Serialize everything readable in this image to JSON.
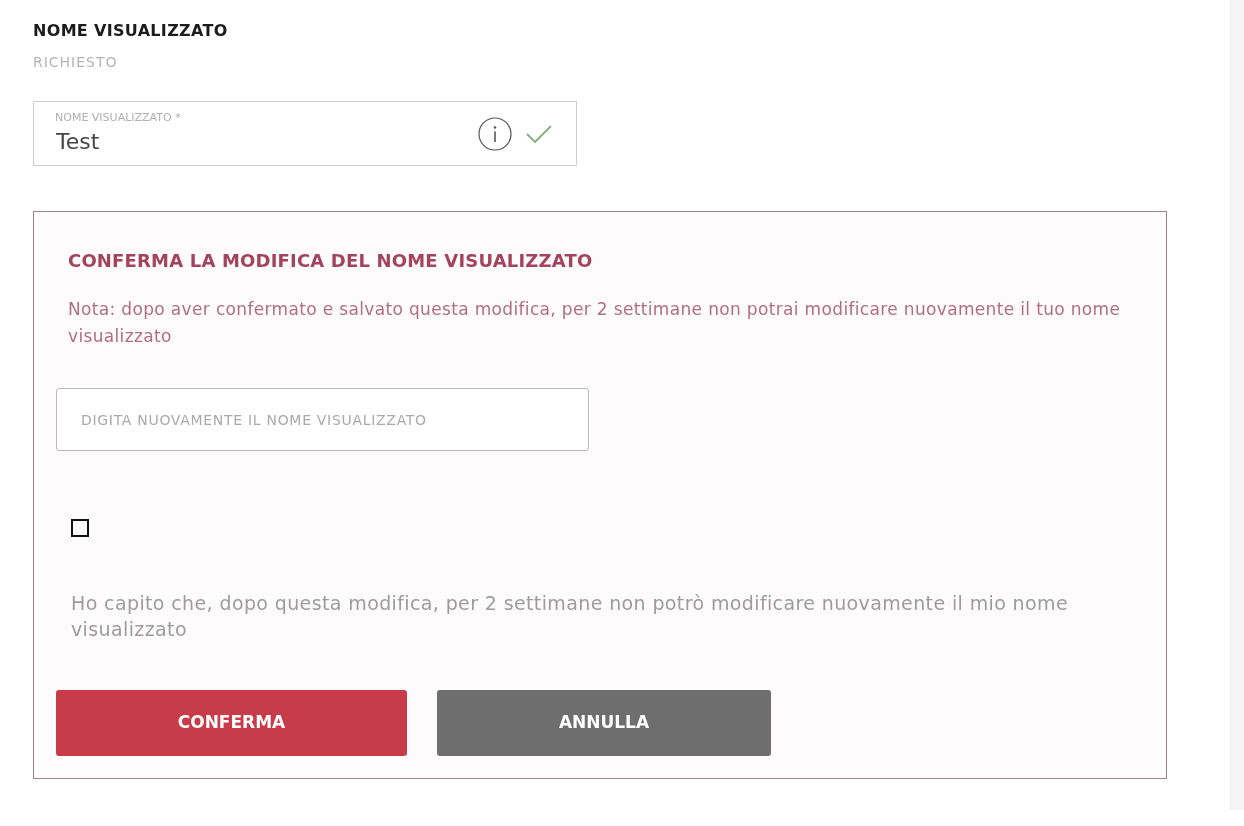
{
  "section": {
    "title": "NOME VISUALIZZATO",
    "subtitle": "RICHIESTO"
  },
  "display_name_field": {
    "label": "NOME VISUALIZZATO *",
    "value": "Test",
    "valid": true
  },
  "confirm_panel": {
    "title": "CONFERMA LA MODIFICA DEL NOME VISUALIZZATO",
    "note": "Nota: dopo aver confermato e salvato questa modifica, per 2 settimane non potrai modificare nuovamente il tuo nome visualizzato",
    "retype_field": {
      "placeholder": "DIGITA NUOVAMENTE IL NOME VISUALIZZATO"
    },
    "acknowledge": {
      "checked": false,
      "label": "Ho capito che, dopo questa modifica, per 2 settimane non potrò modificare nuovamente il mio nome visualizzato"
    },
    "buttons": [
      {
        "label": "CONFERMA",
        "kind": "primary"
      },
      {
        "label": "ANNULLA",
        "kind": "secondary"
      }
    ]
  }
}
